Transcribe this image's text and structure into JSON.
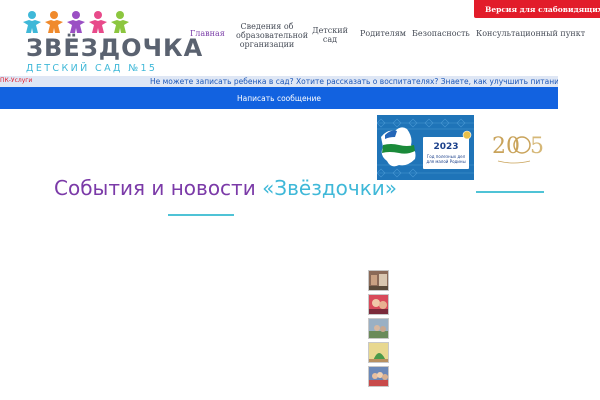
{
  "logo": {
    "title": "ЗВЁЗДОЧКА",
    "subtitle": "ДЕТСКИЙ САД №15",
    "kid_colors": [
      "#3fb8d8",
      "#f08a2c",
      "#9b4fc4",
      "#e84a8a",
      "#8cc63f"
    ]
  },
  "nav": {
    "items": [
      {
        "label": "Главная",
        "active": true
      },
      {
        "label": "Сведения об образовательной организации",
        "active": false
      },
      {
        "label": "Детский сад",
        "active": false
      },
      {
        "label": "Родителям",
        "active": false
      },
      {
        "label": "Безопасность",
        "active": false
      },
      {
        "label": "Консультационный пункт",
        "active": false
      }
    ]
  },
  "accessibility": {
    "label": "Версия для слабовидящих"
  },
  "ticker": {
    "label": "ПК-Услуги",
    "text": "Не можете записать ребенка в сад? Хотите рассказать о воспитателях? Знаете, как улучшить питание и занятия?"
  },
  "write_message": {
    "label": "Написать сообщение"
  },
  "banners": {
    "year": {
      "year": "2023",
      "caption_line1": "Год полезных дел",
      "caption_line2": "для малой Родины"
    },
    "anniversary": {
      "digits": "20",
      "digits2": "5"
    }
  },
  "news": {
    "title_main": "События и новости ",
    "title_accent": "«Звёздочки»"
  },
  "colors": {
    "accent_purple": "#7b3aa8",
    "accent_cyan": "#3fb8d8",
    "accent_red": "#e21c2a",
    "accent_blue": "#1262e0"
  }
}
